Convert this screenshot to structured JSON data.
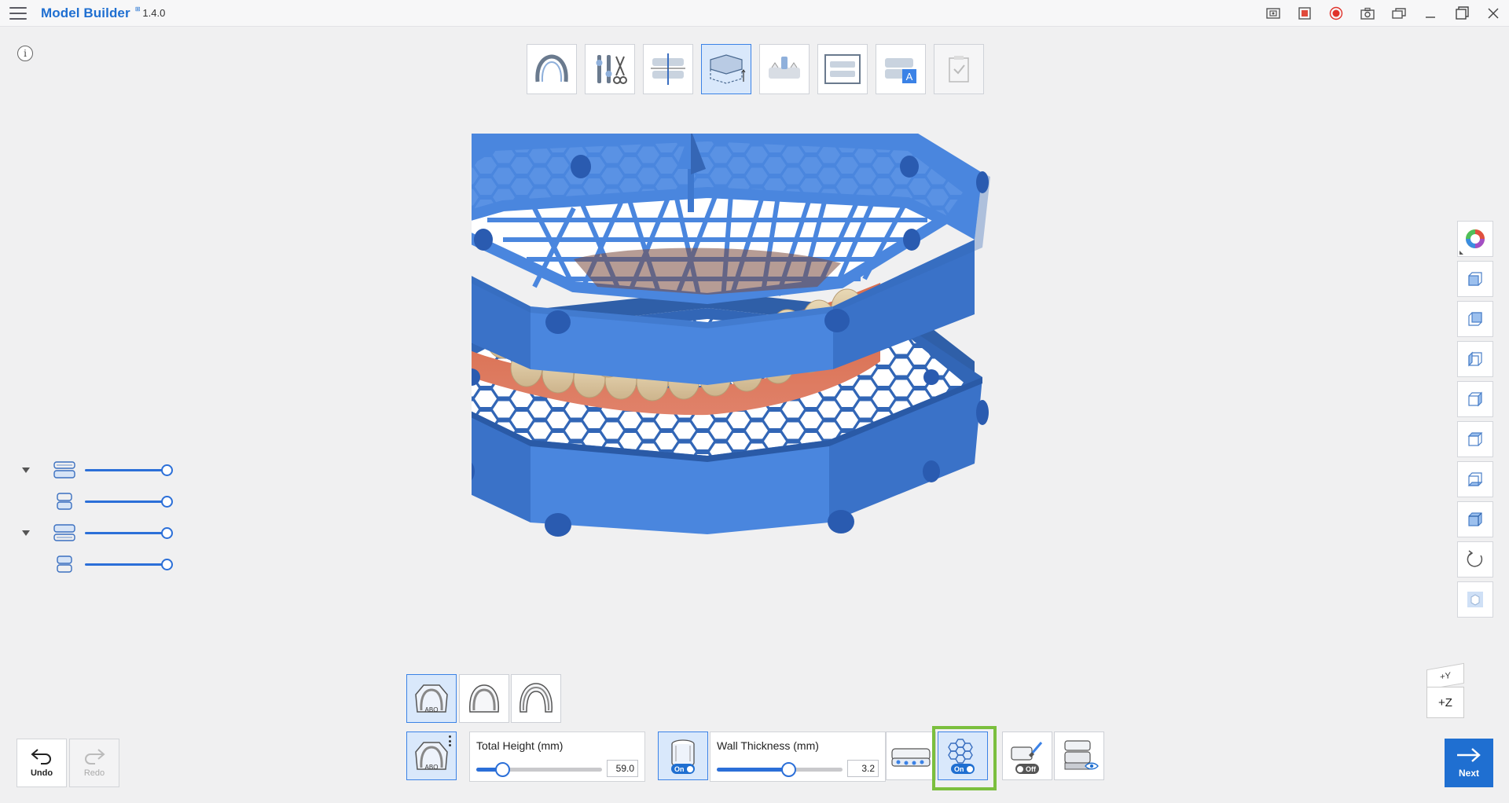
{
  "app": {
    "title": "Model Builder",
    "badge": "⊞",
    "version": "1.4.0"
  },
  "titlebar_icons": [
    "screenshot-gallery-icon",
    "screen-record-icon",
    "record-icon",
    "camera-icon",
    "window-mode-icon",
    "minimize-icon",
    "maximize-icon",
    "close-icon"
  ],
  "info": {
    "label": "i"
  },
  "steps": [
    {
      "name": "arch-step",
      "active": false
    },
    {
      "name": "tools-step",
      "active": false
    },
    {
      "name": "alignment-step",
      "active": false
    },
    {
      "name": "base-step",
      "active": true
    },
    {
      "name": "attachment-step",
      "active": false
    },
    {
      "name": "articulator-step",
      "active": false
    },
    {
      "name": "label-step",
      "active": false
    },
    {
      "name": "complete-step",
      "active": false,
      "disabled": true
    }
  ],
  "layers": [
    {
      "name": "upper-model",
      "level": 1,
      "value": 1.0
    },
    {
      "name": "upper-base",
      "level": 2,
      "value": 1.0
    },
    {
      "name": "lower-model",
      "level": 1,
      "value": 1.0
    },
    {
      "name": "lower-base",
      "level": 2,
      "value": 1.0
    }
  ],
  "view_tools": [
    "color-wheel-icon",
    "view-front-icon",
    "view-back-icon",
    "view-left-icon",
    "view-right-icon",
    "view-top-icon",
    "view-bottom-icon",
    "view-iso-icon",
    "reset-rotation-icon",
    "transparency-icon"
  ],
  "axis": {
    "top_label": "+Y",
    "front_label": "+Z"
  },
  "undo": {
    "label": "Undo"
  },
  "redo": {
    "label": "Redo"
  },
  "base_types": [
    "abo-base",
    "round-base",
    "horseshoe-base"
  ],
  "total_height": {
    "label": "Total Height (mm)",
    "value": "59.0",
    "fraction": 0.17
  },
  "wall_toggle": {
    "state": "On"
  },
  "wall_thickness": {
    "label": "Wall Thickness (mm)",
    "value": "3.2",
    "fraction": 0.58
  },
  "honeycomb_toggle": {
    "state": "On"
  },
  "paint_toggle": {
    "state": "Off"
  },
  "next": {
    "label": "Next"
  },
  "colors": {
    "accent": "#1f6fd1",
    "model_blue": "#4a86de",
    "highlight": "#7bbf3e"
  }
}
